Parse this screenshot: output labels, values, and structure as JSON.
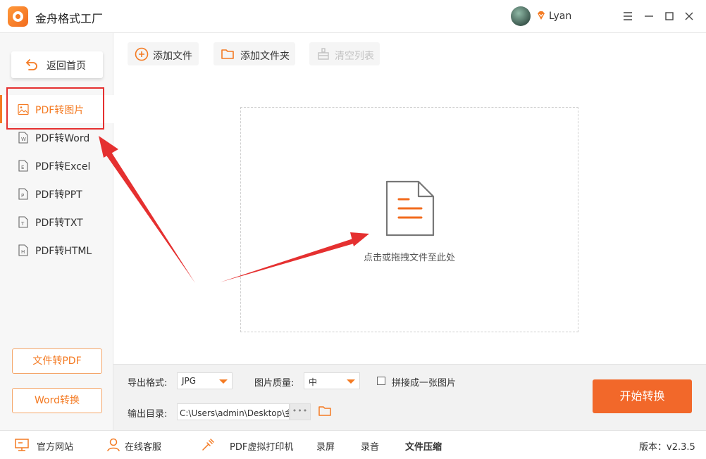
{
  "titlebar": {
    "app_name": "金舟格式工厂",
    "username": "Lyan"
  },
  "sidebar": {
    "back_label": "返回首页",
    "items": [
      {
        "label": "PDF转图片",
        "icon": "image-file-icon",
        "active": true
      },
      {
        "label": "PDF转Word",
        "icon": "word-file-icon",
        "icon_letter": "W"
      },
      {
        "label": "PDF转Excel",
        "icon": "excel-file-icon",
        "icon_letter": "E"
      },
      {
        "label": "PDF转PPT",
        "icon": "ppt-file-icon",
        "icon_letter": "P"
      },
      {
        "label": "PDF转TXT",
        "icon": "txt-file-icon",
        "icon_letter": "T"
      },
      {
        "label": "PDF转HTML",
        "icon": "html-file-icon",
        "icon_letter": "H"
      }
    ],
    "bottom_buttons": [
      "文件转PDF",
      "Word转换"
    ]
  },
  "toolbar": {
    "add_file": "添加文件",
    "add_folder": "添加文件夹",
    "clear_list": "清空列表"
  },
  "dropzone": {
    "hint": "点击或拖拽文件至此处"
  },
  "settings": {
    "format_label": "导出格式:",
    "format_value": "JPG",
    "quality_label": "图片质量:",
    "quality_value": "中",
    "merge_label": "拼接成一张图片",
    "merge_checked": false,
    "output_label": "输出目录:",
    "output_path": "C:\\Users\\admin\\Desktop\\金",
    "browse_dots": "•••",
    "start_label": "开始转换"
  },
  "footer": {
    "website": "官方网站",
    "support": "在线客服",
    "printer": "PDF虚拟打印机",
    "screen_record": "录屏",
    "audio_record": "录音",
    "compress": "文件压缩",
    "version": "版本：v2.3.5"
  },
  "colors": {
    "accent": "#f47a22",
    "start_button": "#f2682a",
    "annotation_red": "#e53030"
  }
}
